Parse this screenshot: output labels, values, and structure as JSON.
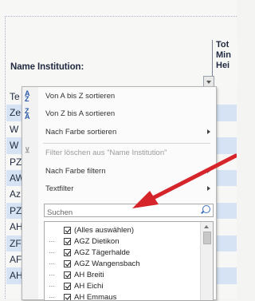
{
  "header": {
    "column_title": "Name Institution:",
    "right_column_lines": [
      "Tot",
      "Min",
      "Hei"
    ],
    "filter_button_icon": "dropdown-arrow-icon"
  },
  "rows": [
    {
      "text": "Te",
      "shaded": false
    },
    {
      "text": "Ze",
      "shaded": true
    },
    {
      "text": "W",
      "shaded": false
    },
    {
      "text": "W",
      "shaded": true
    },
    {
      "text": "PZ",
      "shaded": false
    },
    {
      "text": "AW",
      "shaded": true
    },
    {
      "text": "Az",
      "shaded": false
    },
    {
      "text": "PZ",
      "shaded": true
    },
    {
      "text": "AH",
      "shaded": false
    },
    {
      "text": "ZF",
      "shaded": true
    },
    {
      "text": "AF",
      "shaded": false
    },
    {
      "text": "AH",
      "shaded": true
    }
  ],
  "menu": {
    "sort_az": "Von A bis Z sortieren",
    "sort_za": "Von Z bis A sortieren",
    "sort_by_color": "Nach Farbe sortieren",
    "clear_filter": "Filter löschen aus \"Name Institution\"",
    "filter_by_color": "Nach Farbe filtern",
    "text_filter": "Textfilter",
    "search_placeholder": "Suchen",
    "items": [
      "(Alles auswählen)",
      "AGZ Dietikon",
      "AGZ Tägerhalde",
      "AGZ Wangensbach",
      "AH Breiti",
      "AH Eichi",
      "AH Emmaus"
    ]
  },
  "colors": {
    "annotation_arrow": "#d6252a",
    "row_shade": "#d6e3f4"
  }
}
